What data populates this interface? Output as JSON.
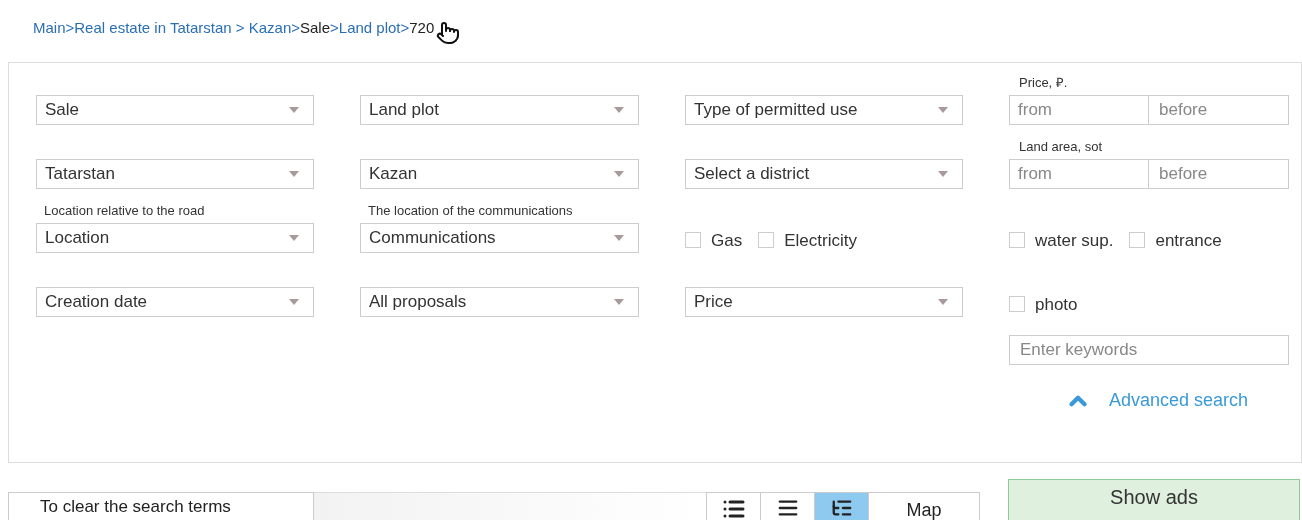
{
  "breadcrumb": [
    {
      "text": "Main>",
      "link": true
    },
    {
      "text": "Real estate in Tatarstan > ",
      "link": true
    },
    {
      "text": "Kazan>",
      "link": true
    },
    {
      "text": "Sale",
      "link": false
    },
    {
      "text": ">Land plot>",
      "link": true
    },
    {
      "text": "720",
      "link": false
    }
  ],
  "rows": [
    {
      "cells": [
        {
          "kind": "select",
          "value": "Sale"
        },
        {
          "kind": "select",
          "value": "Land plot"
        },
        {
          "kind": "select",
          "value": "Type of permitted use"
        },
        {
          "kind": "range",
          "label": "Price, ₽.",
          "from": {
            "placeholder": "from"
          },
          "to": {
            "placeholder": "before"
          }
        }
      ]
    },
    {
      "cells": [
        {
          "kind": "select",
          "value": "Tatarstan"
        },
        {
          "kind": "select",
          "value": "Kazan"
        },
        {
          "kind": "select",
          "value": "Select a district"
        },
        {
          "kind": "range",
          "label": "Land area, sot",
          "from": {
            "placeholder": "from"
          },
          "to": {
            "placeholder": "before"
          }
        }
      ]
    },
    {
      "cells": [
        {
          "kind": "select",
          "label": "Location relative to the road",
          "value": "Location"
        },
        {
          "kind": "select",
          "label": "The location of the communications",
          "value": "Communications"
        },
        {
          "kind": "checks",
          "items": [
            {
              "label": "Gas",
              "checked": false
            },
            {
              "label": "Electricity",
              "checked": false
            }
          ]
        },
        {
          "kind": "checks",
          "items": [
            {
              "label": "water sup.",
              "checked": false
            },
            {
              "label": "entrance",
              "checked": false
            }
          ]
        }
      ]
    },
    {
      "cells": [
        {
          "kind": "select",
          "value": "Creation date"
        },
        {
          "kind": "select",
          "value": "All proposals"
        },
        {
          "kind": "select",
          "value": "Price"
        },
        {
          "kind": "checks",
          "items": [
            {
              "label": "photo",
              "checked": false
            }
          ]
        }
      ]
    }
  ],
  "keywords": {
    "placeholder": "Enter keywords"
  },
  "advanced_search": {
    "label": "Advanced search",
    "expanded": true
  },
  "clear_button": "To clear the search terms",
  "views": [
    {
      "kind": "list",
      "selected": false
    },
    {
      "kind": "compact",
      "selected": false
    },
    {
      "kind": "detailed",
      "selected": true
    },
    {
      "kind": "text",
      "label": "Map",
      "selected": false
    }
  ],
  "show_ads": "Show ads"
}
